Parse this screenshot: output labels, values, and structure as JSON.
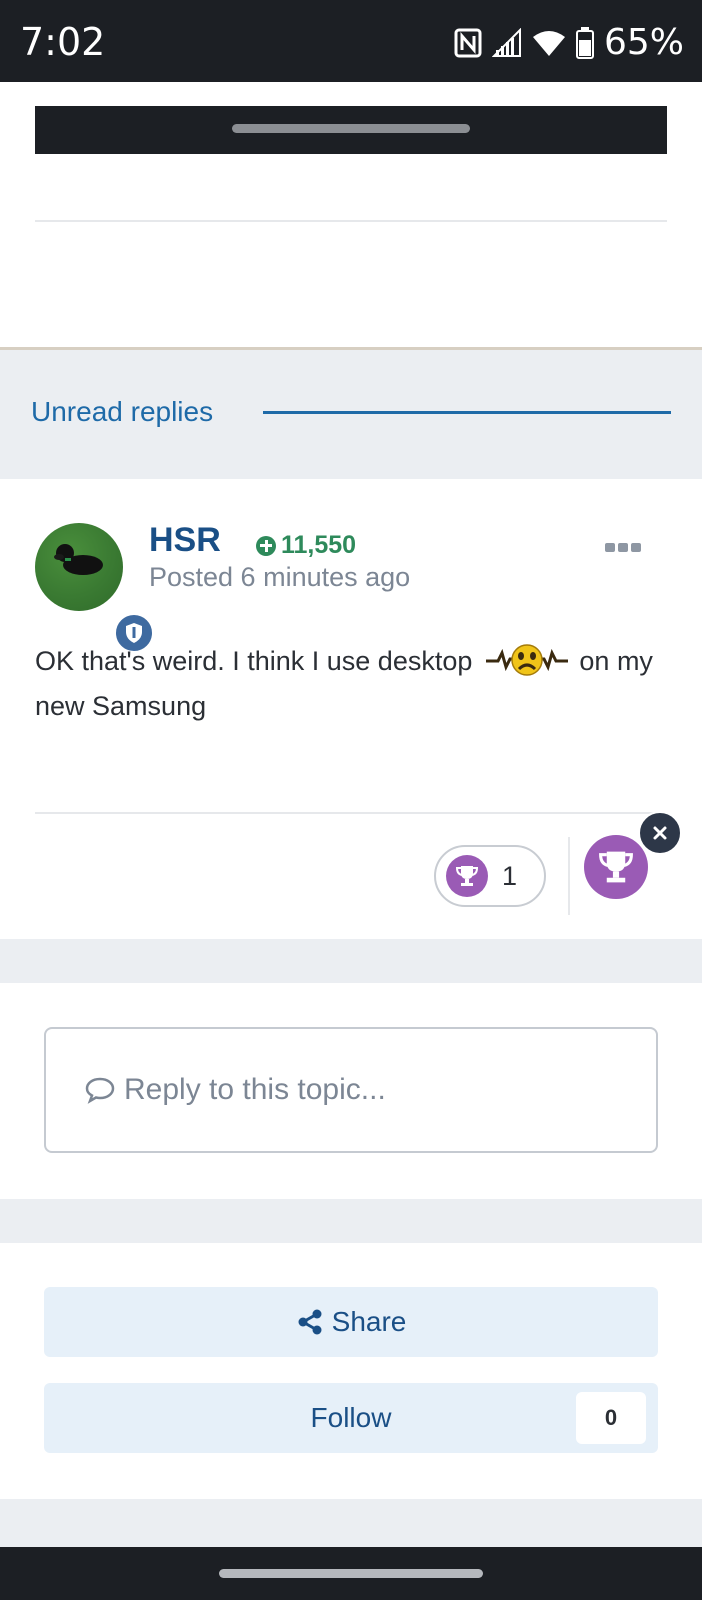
{
  "status_bar": {
    "time": "7:02",
    "battery": "65%",
    "icons": [
      "nfc-icon",
      "signal-icon",
      "wifi-icon",
      "battery-icon"
    ]
  },
  "section": {
    "unread_label": "Unread replies"
  },
  "post": {
    "username": "HSR",
    "reputation": "11,550",
    "posted": "Posted 6 minutes ago",
    "content_before_emoji": "OK that's weird. I think I use desktop",
    "content_after_emoji": "on my new Samsung",
    "reaction_count": "1",
    "reaction_icon": "trophy-icon"
  },
  "reply": {
    "placeholder": "Reply to this topic..."
  },
  "actions": {
    "share_label": "Share",
    "follow_label": "Follow",
    "follow_count": "0"
  },
  "colors": {
    "accent": "#1e6aa8",
    "link": "#1a4f86",
    "reputation_green": "#2e8a5b",
    "trophy_purple": "#9a5bb5",
    "button_bg": "#e6f0f9"
  }
}
